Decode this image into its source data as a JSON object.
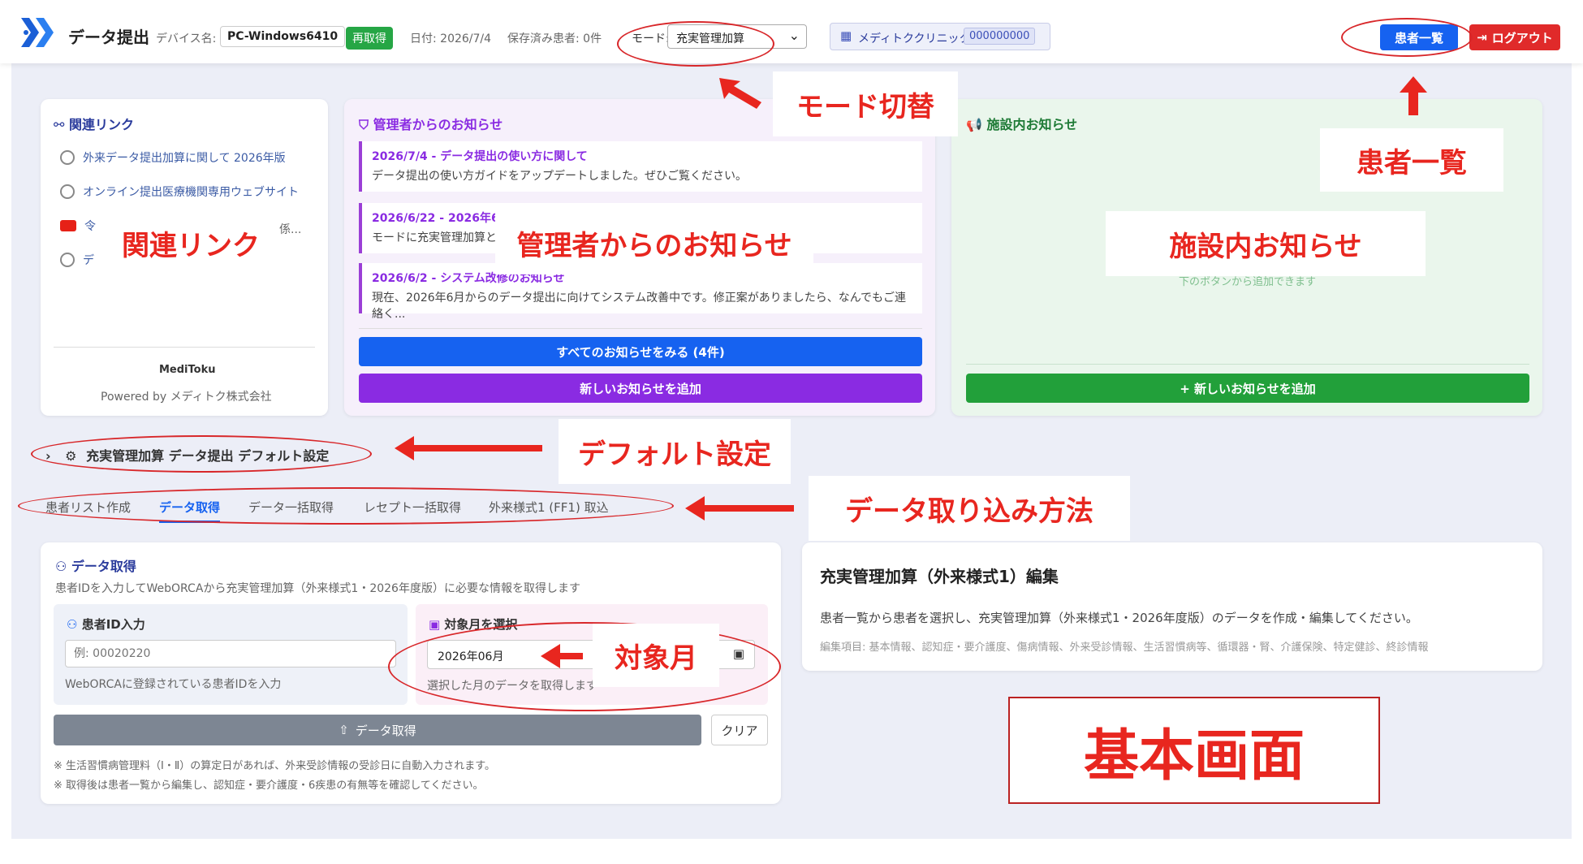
{
  "header": {
    "app_title": "データ提出",
    "device_label": "デバイス名:",
    "device_name": "PC-Windows6410",
    "reacquire_label": "再取得",
    "date_text": "日付: 2026/7/4",
    "saved_patients_text": "保存済み患者: 0件",
    "mode_label": "モード:",
    "mode_value": "充実管理加算",
    "clinic_name": "メディトククリニック",
    "clinic_code": "000000000",
    "patients_button": "患者一覧",
    "logout_button": "ログアウト"
  },
  "related_links": {
    "title": "関連リンク",
    "items": [
      {
        "label": "外来データ提出加算に関して 2026年版"
      },
      {
        "label": "オンライン提出医療機関専用ウェブサイト"
      },
      {
        "label": "令"
      },
      {
        "label": "デ"
      }
    ],
    "item3_suffix": "係...",
    "brand": "MediToku",
    "powered_by": "Powered by メディトク株式会社"
  },
  "admin_notices": {
    "title": "管理者からのお知らせ",
    "items": [
      {
        "title": "2026/7/4 - データ提出の使い方に関して",
        "body": "データ提出の使い方ガイドをアップデートしました。ぜひご覧ください。"
      },
      {
        "title": "2026/6/22 - 2026年6",
        "body": "モードに充実管理加算と"
      },
      {
        "title": "2026/6/2 - システム改修のお知らせ",
        "body": "現在、2026年6月からのデータ提出に向けてシステム改善中です。修正案がありましたら、なんでもご連絡く..."
      }
    ],
    "view_all_button": "すべてのお知らせをみる (4件)",
    "add_button": "新しいお知らせを追加"
  },
  "facility_notices": {
    "title": "施設内お知らせ",
    "hint": "下のボタンから追加できます",
    "add_button": "+ 新しいお知らせを追加"
  },
  "default_settings": {
    "label": "充実管理加算 データ提出 デフォルト設定"
  },
  "tabs": [
    {
      "label": "患者リスト作成"
    },
    {
      "label": "データ取得"
    },
    {
      "label": "データ一括取得"
    },
    {
      "label": "レセプト一括取得"
    },
    {
      "label": "外来様式1 (FF1) 取込"
    }
  ],
  "data_fetch": {
    "title": "データ取得",
    "description": "患者IDを入力してWebORCAから充実管理加算（外来様式1・2026年度版）に必要な情報を取得します",
    "patient_id_label": "患者ID入力",
    "patient_id_placeholder": "例: 00020220",
    "patient_id_hint": "WebORCAに登録されている患者IDを入力",
    "month_label": "対象月を選択",
    "month_value": "2026年06月",
    "month_hint": "選択した月のデータを取得します",
    "fetch_button": "データ取得",
    "clear_button": "クリア",
    "note1": "※ 生活習慣病管理料（Ⅰ・Ⅱ）の算定日があれば、外来受診情報の受診日に自動入力されます。",
    "note2": "※ 取得後は患者一覧から編集し、認知症・要介護度・6疾患の有無等を確認してください。"
  },
  "edit_panel": {
    "title": "充実管理加算（外来様式1）編集",
    "description": "患者一覧から患者を選択し、充実管理加算（外来様式1・2026年度版）のデータを作成・編集してください。",
    "items": "編集項目: 基本情報、認知症・要介護度、傷病情報、外来受診情報、生活習慣病等、循環器・腎、介護保険、特定健診、終診情報"
  },
  "annotations": {
    "mode_switch": "モード切替",
    "patient_list": "患者一覧",
    "related_links": "関連リンク",
    "admin_notices": "管理者からのお知らせ",
    "facility_notices": "施設内お知らせ",
    "default_settings": "デフォルト設定",
    "import_method": "データ取り込み方法",
    "target_month": "対象月",
    "basic_screen": "基本画面"
  },
  "colors": {
    "blue": "#1662f0",
    "purple": "#8a2be2",
    "green": "#22a03a",
    "red": "#e8261f",
    "gray_button": "#7d8693"
  }
}
